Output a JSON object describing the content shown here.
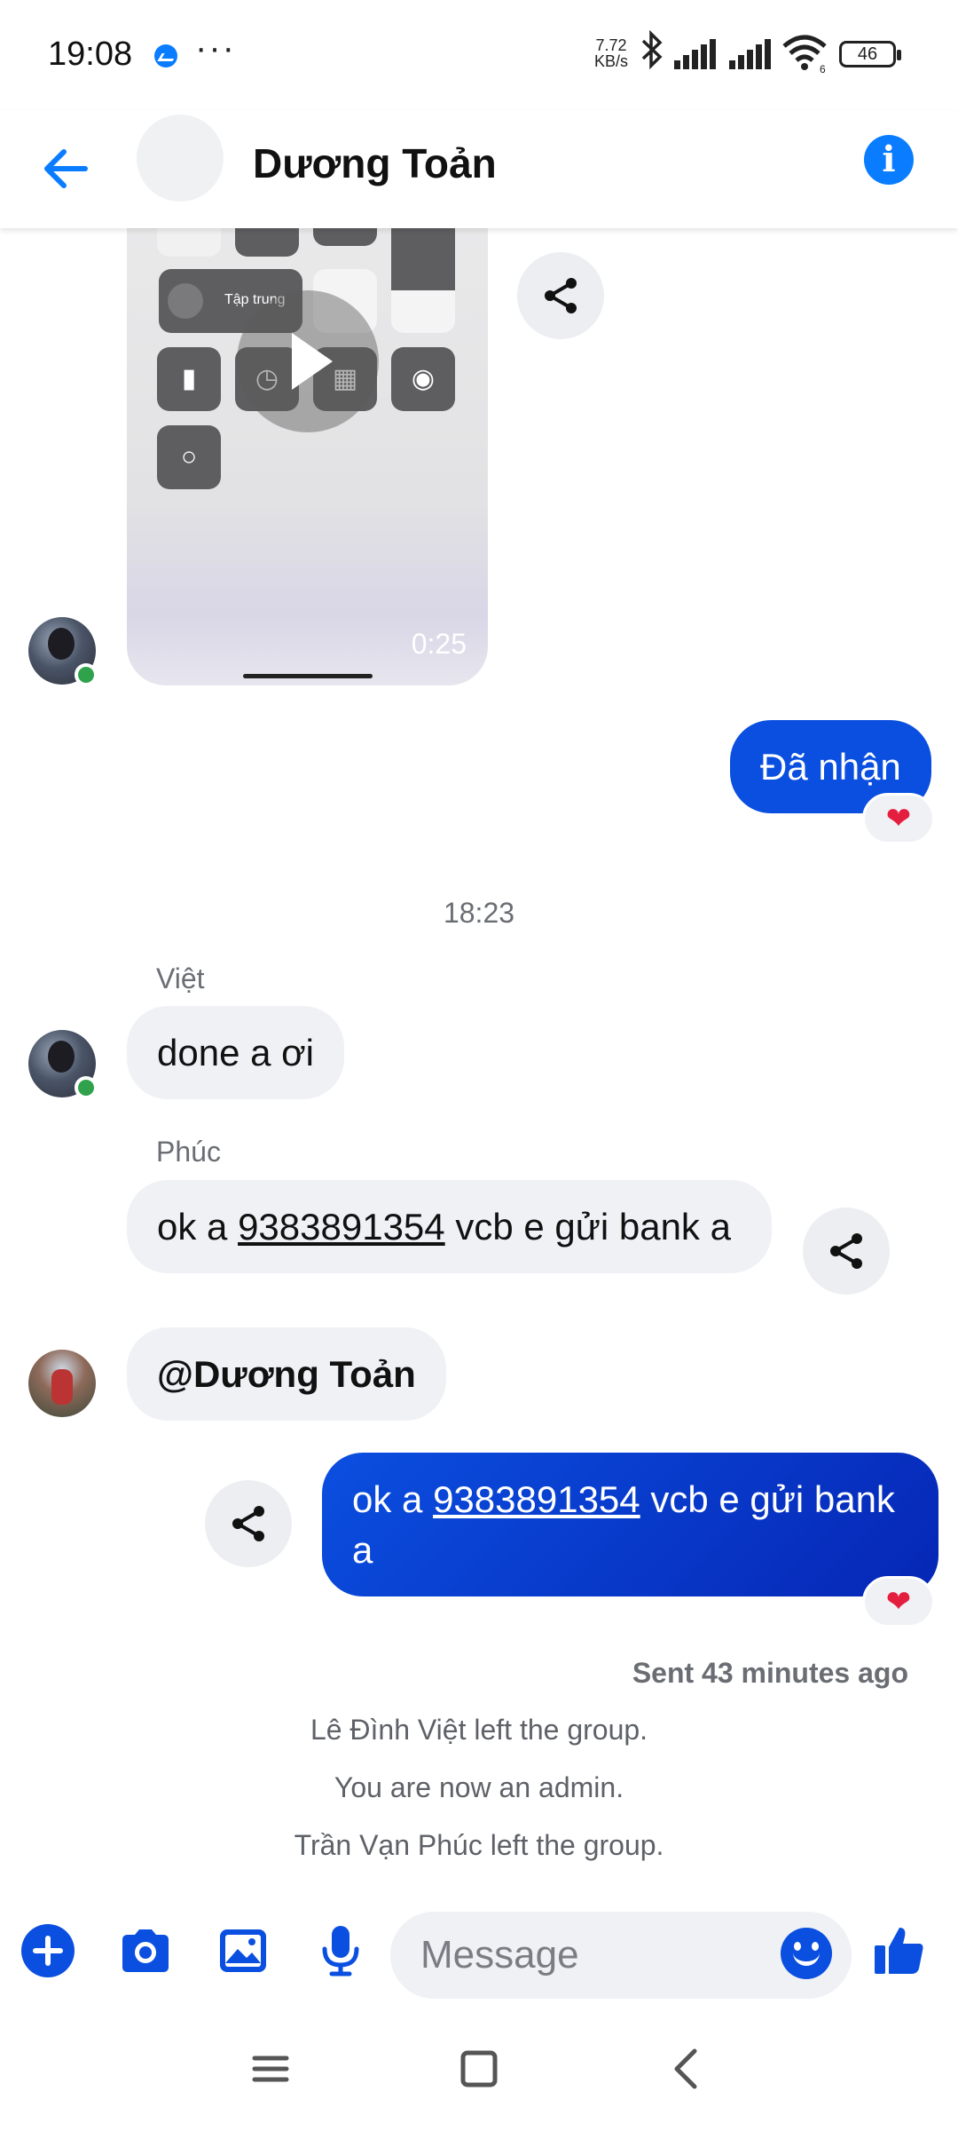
{
  "status_bar": {
    "time": "19:08",
    "more": "···",
    "net_speed_value": "7.72",
    "net_speed_unit": "KB/s",
    "wifi_sub": "6",
    "battery": "46"
  },
  "header": {
    "title": "Dương Toản",
    "back_icon": "arrow-left-icon",
    "info_icon": "info-icon",
    "info_glyph": "i"
  },
  "video": {
    "duration": "0:25",
    "focus_label": "Tập trung"
  },
  "messages": {
    "out_received": "Đã nhận",
    "timestamp_1": "18:23",
    "sender_viet": "Việt",
    "viet_text": "done a ơi",
    "sender_phuc": "Phúc",
    "phuc_prefix": "ok a ",
    "phuc_number": "9383891354",
    "phuc_suffix": " vcb e gửi bank a",
    "mention_text": "@Dương Toản",
    "out_prefix": "ok a ",
    "out_number": "9383891354",
    "out_suffix": " vcb e gửi bank a",
    "reaction": "❤",
    "sent_status": "Sent 43 minutes ago"
  },
  "system": {
    "left_viet": "Lê Đình Việt left the group.",
    "admin": "You are now an admin.",
    "left_phuc": "Trần Vạn Phúc left the group."
  },
  "composer": {
    "placeholder": "Message",
    "value": ""
  },
  "colors": {
    "accent": "#0a7cff",
    "outgoing_bubble": "#0a4fe0",
    "incoming_bubble": "#eff1f5",
    "online": "#31a24c",
    "heart": "#e41e3f"
  }
}
